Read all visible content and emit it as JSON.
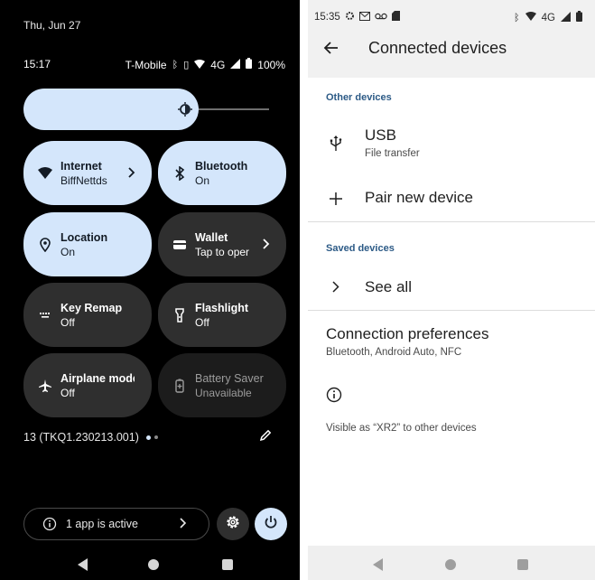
{
  "quick_settings": {
    "date": "Thu, Jun 27",
    "status_bar": {
      "time": "15:17",
      "carrier": "T-Mobile",
      "network": "4G",
      "battery": "100%"
    },
    "brightness_level": 0.7,
    "tiles": [
      {
        "title": "Internet",
        "subtitle": "BiffNettds",
        "state": "on",
        "icon": "wifi-icon",
        "has_chevron": true
      },
      {
        "title": "Bluetooth",
        "subtitle": "On",
        "state": "on",
        "icon": "bluetooth-icon",
        "has_chevron": false
      },
      {
        "title": "Location",
        "subtitle": "On",
        "state": "on",
        "icon": "location-icon",
        "has_chevron": false
      },
      {
        "title": "Wallet",
        "subtitle": "Tap to oper",
        "state": "off",
        "icon": "wallet-icon",
        "has_chevron": true
      },
      {
        "title": "Key Remap",
        "subtitle": "Off",
        "state": "off",
        "icon": "keyboard-icon",
        "has_chevron": false
      },
      {
        "title": "Flashlight",
        "subtitle": "Off",
        "state": "off",
        "icon": "flashlight-icon",
        "has_chevron": false
      },
      {
        "title": "Airplane mode",
        "subtitle": "Off",
        "state": "off",
        "icon": "airplane-icon",
        "has_chevron": false
      },
      {
        "title": "Battery Saver",
        "subtitle": "Unavailable",
        "state": "unavailable",
        "icon": "battery-saver-icon",
        "has_chevron": false
      }
    ],
    "build_number": "13 (TKQ1.230213.001)",
    "active_apps": "1 app is active"
  },
  "connected_devices": {
    "status_bar": {
      "time": "15:35",
      "network": "4G"
    },
    "title": "Connected devices",
    "other_devices_header": "Other devices",
    "usb": {
      "title": "USB",
      "subtitle": "File transfer"
    },
    "pair_new": "Pair new device",
    "saved_devices_header": "Saved devices",
    "see_all": "See all",
    "connection_preferences": {
      "title": "Connection preferences",
      "subtitle": "Bluetooth, Android Auto, NFC"
    },
    "visible_as": "Visible as “XR2” to other devices"
  },
  "colors": {
    "tile_on": "#d4e6fb",
    "tile_off": "#2f2f2f",
    "section_header": "#2c5a86",
    "app_bar": "#f1f1f1"
  }
}
